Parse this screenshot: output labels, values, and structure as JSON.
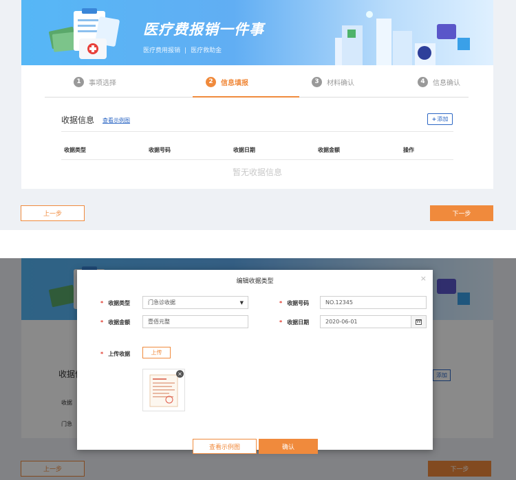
{
  "banner": {
    "title": "医疗费报销一件事",
    "sub_left": "医疗费用报销",
    "sub_sep": "|",
    "sub_right": "医疗救助金"
  },
  "steps": [
    {
      "num": "1",
      "label": "事项选择",
      "active": false
    },
    {
      "num": "2",
      "label": "信息填报",
      "active": true
    },
    {
      "num": "3",
      "label": "材料确认",
      "active": false
    },
    {
      "num": "4",
      "label": "信息确认",
      "active": false
    }
  ],
  "receipt_section": {
    "title": "收据信息",
    "example_link": "查看示例图",
    "add_button": "添加",
    "columns": [
      "收据类型",
      "收据号码",
      "收据日期",
      "收据金额",
      "操作"
    ],
    "empty_text": "暂无收据信息"
  },
  "nav": {
    "prev": "上一步",
    "next": "下一步"
  },
  "background_partial": {
    "section_title": "收据信",
    "add_fragment": "添加",
    "col_fragment": "收据",
    "row_fragment": "门急",
    "prev": "上一步",
    "next": "下一步"
  },
  "modal": {
    "title": "编辑收据类型",
    "close": "×",
    "required_mark": "*",
    "type_label": "收据类型",
    "type_value": "门急诊收据",
    "number_label": "收据号码",
    "number_value": "NO.12345",
    "amount_label": "收据金额",
    "amount_placeholder": "壹佰元整",
    "date_label": "收据日期",
    "date_value": "2020-06-01",
    "upload_label": "上传收据",
    "upload_button": "上传",
    "example_button": "查看示例图",
    "confirm_button": "确认"
  },
  "colors": {
    "accent": "#f08a3c",
    "link": "#2b66c4",
    "banner_start": "#56b7f6"
  }
}
